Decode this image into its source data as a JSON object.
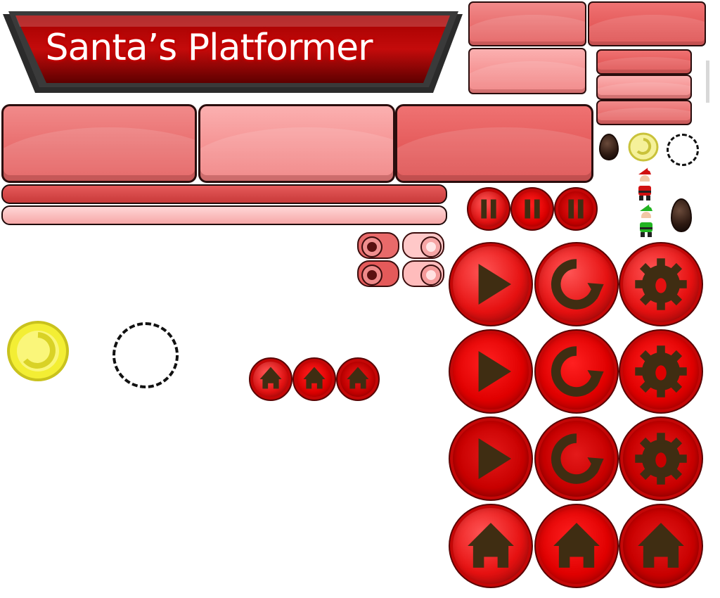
{
  "game": {
    "title": "Santa’s Platformer"
  },
  "colors": {
    "banner_dark": "#7a0000",
    "banner_red": "#c90a0a",
    "panel_red": "#e25757",
    "panel_pink": "#fbb0b0",
    "button_red": "#e31010",
    "coin_yellow": "#f2ef3a",
    "icon_brown": "#3f2d12"
  },
  "sprites": {
    "buttons": [
      {
        "icon": "play-icon"
      },
      {
        "icon": "restart-icon"
      },
      {
        "icon": "gear-icon"
      },
      {
        "icon": "home-icon"
      }
    ],
    "small_buttons": [
      {
        "icon": "pause-icon"
      },
      {
        "icon": "home-icon"
      }
    ],
    "characters": [
      "santa-red",
      "santa-green"
    ]
  }
}
